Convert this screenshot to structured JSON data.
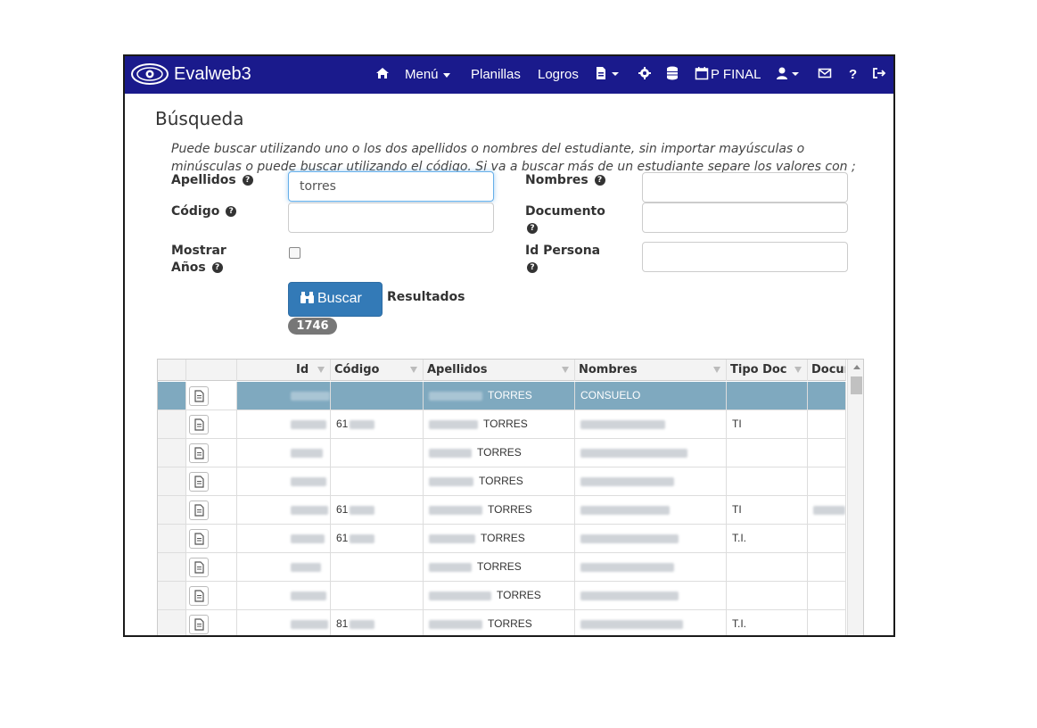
{
  "navbar": {
    "brand": "Evalweb3",
    "home_icon": "home-icon",
    "menu_label": "Menú",
    "planillas_label": "Planillas",
    "logros_label": "Logros",
    "period_label": "P FINAL",
    "icons": [
      "file-icon",
      "gear-icon",
      "database-icon",
      "calendar-icon",
      "user-icon",
      "envelope-icon",
      "question-icon",
      "logout-icon"
    ],
    "color": "#1a1a8c"
  },
  "page": {
    "title": "Búsqueda",
    "help_text": "Puede buscar utilizando uno o los dos apellidos o nombres del estudiante, sin importar mayúsculas o minúsculas o puede buscar utilizando el código. Si va a buscar más de un estudiante separe los valores con ;"
  },
  "form": {
    "apellidos_label": "Apellidos",
    "apellidos_value": "torres",
    "codigo_label": "Código",
    "codigo_value": "",
    "mostrar_label_1": "Mostrar",
    "mostrar_label_2": "Años",
    "nombres_label": "Nombres",
    "nombres_value": "",
    "documento_label": "Documento",
    "documento_value": "",
    "idpersona_label": "Id Persona",
    "idpersona_value": "",
    "help_icon": "?",
    "buscar_label": "Buscar",
    "resultados_label": "Resultados",
    "count": "1746"
  },
  "grid": {
    "columns": [
      "Id",
      "Código",
      "Apellidos",
      "Nombres",
      "Tipo Doc",
      "Docur"
    ],
    "rows": [
      {
        "codigo": "",
        "apellidos": "TORRES",
        "nombres": "CONSUELO",
        "tipo": "",
        "selected": true
      },
      {
        "codigo": "61",
        "apellidos": "TORRES",
        "nombres": "",
        "tipo": "TI",
        "selected": false
      },
      {
        "codigo": "",
        "apellidos": "TORRES",
        "nombres": "",
        "tipo": "",
        "selected": false
      },
      {
        "codigo": "",
        "apellidos": "TORRES",
        "nombres": "",
        "tipo": "",
        "selected": false
      },
      {
        "codigo": "61",
        "apellidos": "TORRES",
        "nombres": "",
        "tipo": "TI",
        "selected": false
      },
      {
        "codigo": "61",
        "apellidos": "TORRES",
        "nombres": "",
        "tipo": "T.I.",
        "selected": false
      },
      {
        "codigo": "",
        "apellidos": "TORRES",
        "nombres": "",
        "tipo": "",
        "selected": false
      },
      {
        "codigo": "",
        "apellidos": "TORRES",
        "nombres": "",
        "tipo": "",
        "selected": false
      },
      {
        "codigo": "81",
        "apellidos": "TORRES",
        "nombres": "",
        "tipo": "T.I.",
        "selected": false
      }
    ],
    "selected_color": "#7fa9bf"
  }
}
